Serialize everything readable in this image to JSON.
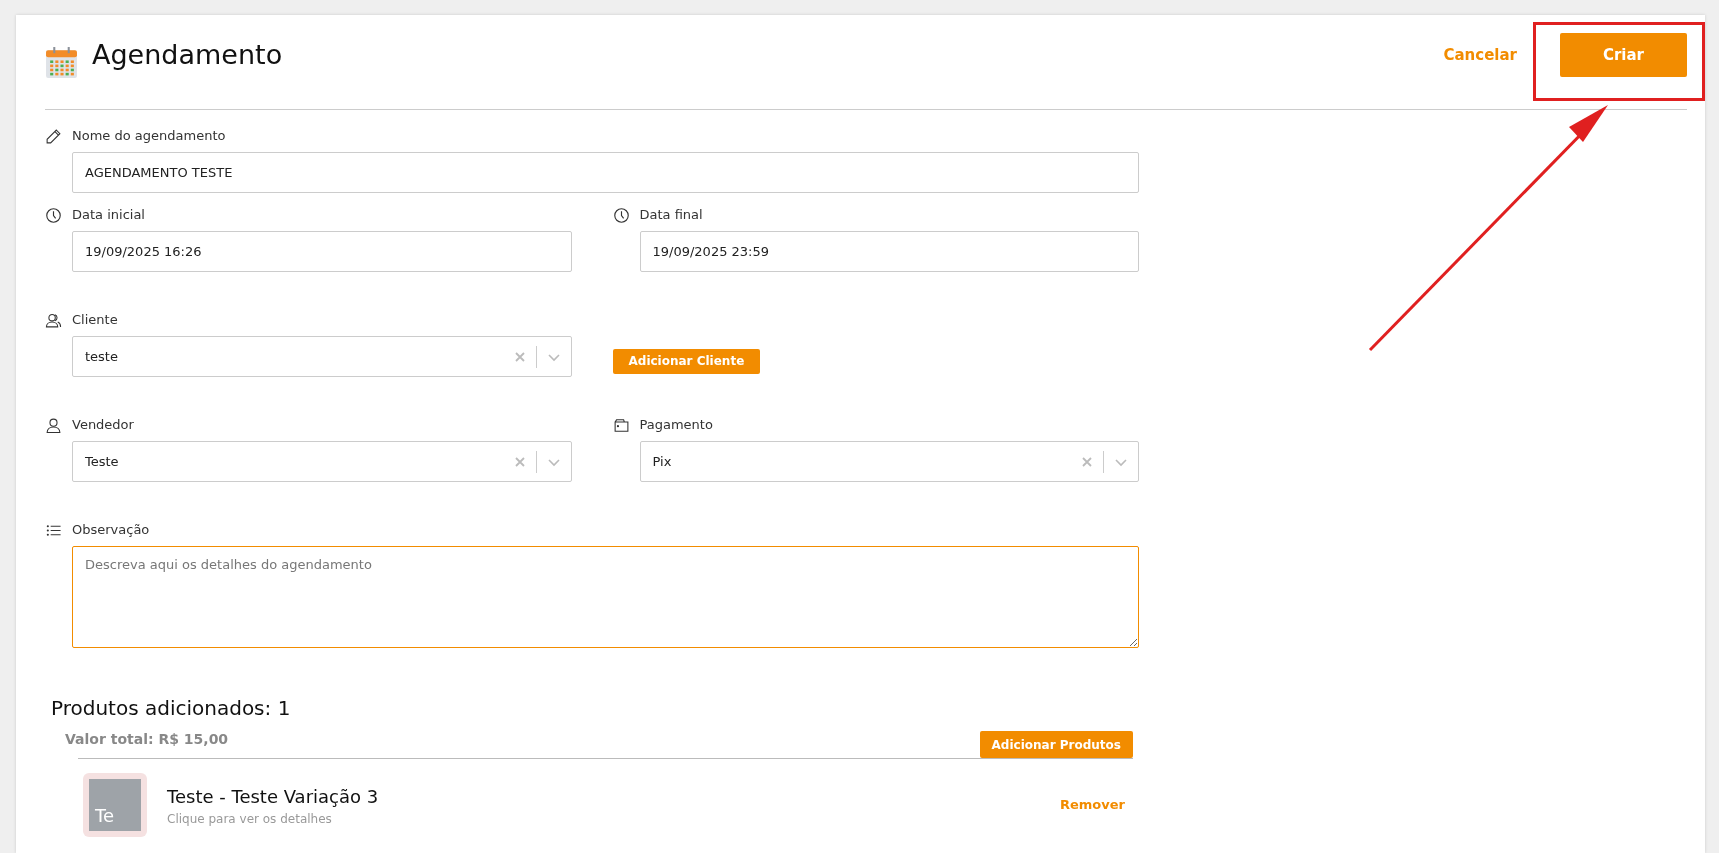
{
  "header": {
    "title": "Agendamento",
    "cancel": "Cancelar",
    "create": "Criar"
  },
  "fields": {
    "name": {
      "label": "Nome do agendamento",
      "value": "AGENDAMENTO TESTE"
    },
    "start": {
      "label": "Data inicial",
      "value": "19/09/2025 16:26"
    },
    "end": {
      "label": "Data final",
      "value": "19/09/2025 23:59"
    },
    "client": {
      "label": "Cliente",
      "value": "teste",
      "action": "Adicionar Cliente"
    },
    "seller": {
      "label": "Vendedor",
      "value": "Teste"
    },
    "payment": {
      "label": "Pagamento",
      "value": "Pix"
    },
    "notes": {
      "label": "Observação",
      "placeholder": "Descreva aqui os detalhes do agendamento"
    }
  },
  "products": {
    "heading": "Produtos adicionados: 1",
    "total": "Valor total: R$ 15,00",
    "add": "Adicionar Produtos",
    "items": [
      {
        "initials": "Te",
        "name": "Teste - Teste Variação 3",
        "hint": "Clique para ver os detalhes",
        "remove": "Remover"
      }
    ]
  }
}
